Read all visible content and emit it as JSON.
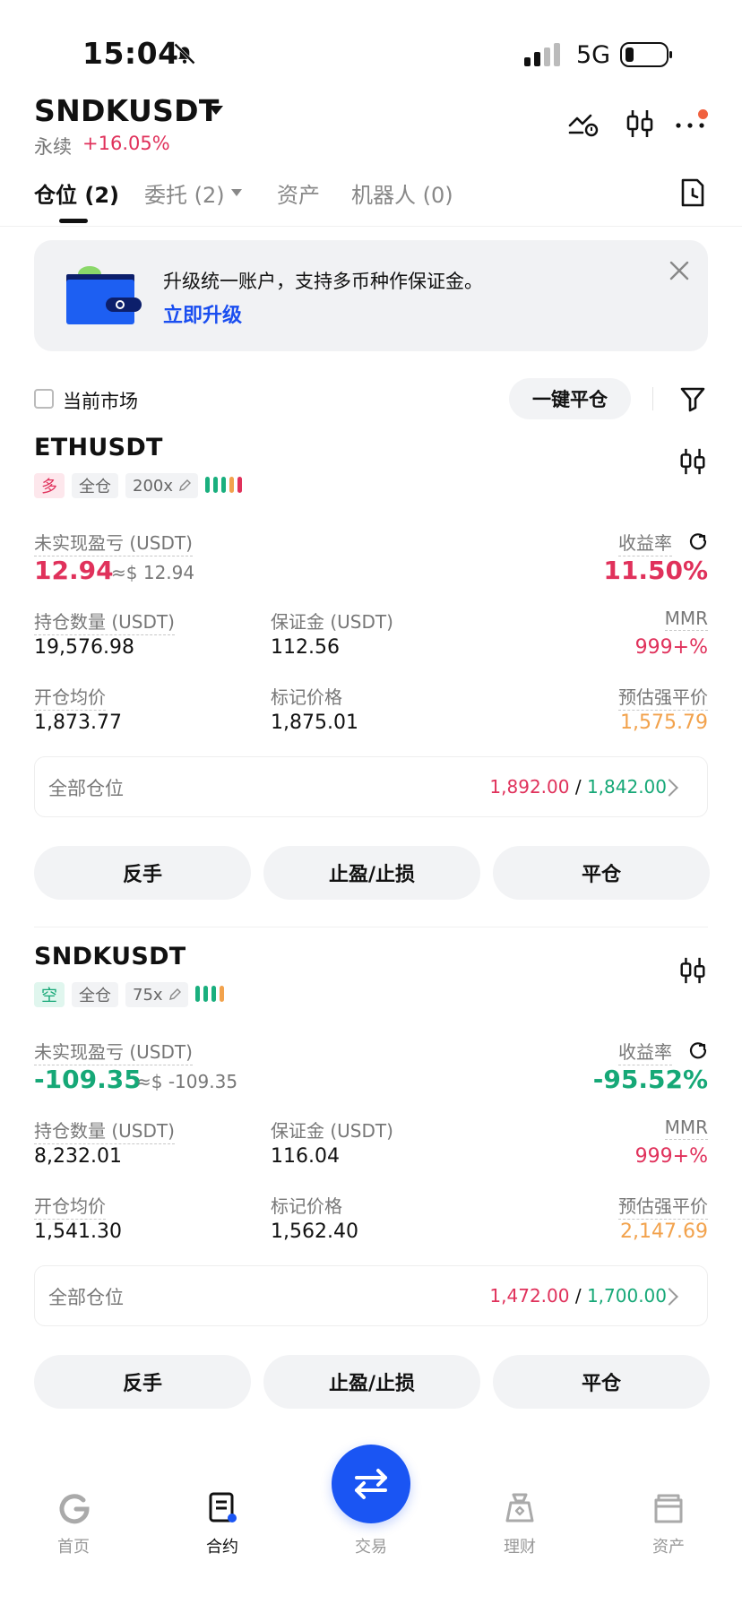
{
  "status_bar": {
    "time": "15:04",
    "network": "5G"
  },
  "header": {
    "symbol": "SNDKUSDT",
    "type": "永续",
    "change": "+16.05%"
  },
  "tabs": [
    {
      "label": "仓位 (2)"
    },
    {
      "label": "委托 (2)"
    },
    {
      "label": "资产"
    },
    {
      "label": "机器人 (0)"
    }
  ],
  "banner": {
    "text": "升级统一账户，支持多币种作保证金。",
    "link": "立即升级"
  },
  "filter_bar": {
    "current_market": "当前市场",
    "close_all": "一键平仓"
  },
  "positions": [
    {
      "symbol": "ETHUSDT",
      "side": "多",
      "margin_mode": "全仓",
      "leverage": "200x",
      "pnl_label": "未实现盈亏 (USDT)",
      "pnl": "12.94",
      "pnl_usd": "≈$ 12.94",
      "roe_label": "收益率",
      "roe": "11.50%",
      "size_label": "持仓数量 (USDT)",
      "size": "19,576.98",
      "margin_label": "保证金 (USDT)",
      "margin": "112.56",
      "mmr_label": "MMR",
      "mmr": "999+%",
      "entry_label": "开仓均价",
      "entry": "1,873.77",
      "mark_label": "标记价格",
      "mark": "1,875.01",
      "liq_label": "预估强平价",
      "liq": "1,575.79",
      "all_label": "全部仓位",
      "tp": "1,892.00",
      "slash": "/",
      "sl": "1,842.00",
      "btn_reverse": "反手",
      "btn_tpsl": "止盈/止损",
      "btn_close": "平仓"
    },
    {
      "symbol": "SNDKUSDT",
      "side": "空",
      "margin_mode": "全仓",
      "leverage": "75x",
      "pnl_label": "未实现盈亏 (USDT)",
      "pnl": "-109.35",
      "pnl_usd": "≈$ -109.35",
      "roe_label": "收益率",
      "roe": "-95.52%",
      "size_label": "持仓数量 (USDT)",
      "size": "8,232.01",
      "margin_label": "保证金 (USDT)",
      "margin": "116.04",
      "mmr_label": "MMR",
      "mmr": "999+%",
      "entry_label": "开仓均价",
      "entry": "1,541.30",
      "mark_label": "标记价格",
      "mark": "1,562.40",
      "liq_label": "预估强平价",
      "liq": "2,147.69",
      "all_label": "全部仓位",
      "tp": "1,472.00",
      "slash": "/",
      "sl": "1,700.00",
      "btn_reverse": "反手",
      "btn_tpsl": "止盈/止损",
      "btn_close": "平仓"
    }
  ],
  "bottom_nav": [
    {
      "label": "首页",
      "icon": "home-icon"
    },
    {
      "label": "合约",
      "icon": "contract-icon"
    },
    {
      "label": "交易",
      "icon": "swap-icon"
    },
    {
      "label": "理财",
      "icon": "finance-icon"
    },
    {
      "label": "资产",
      "icon": "wallet-icon"
    }
  ],
  "colors": {
    "up": "#e0315b",
    "down": "#16a877",
    "accent": "#1a55f3",
    "liq": "#f2a24c"
  }
}
